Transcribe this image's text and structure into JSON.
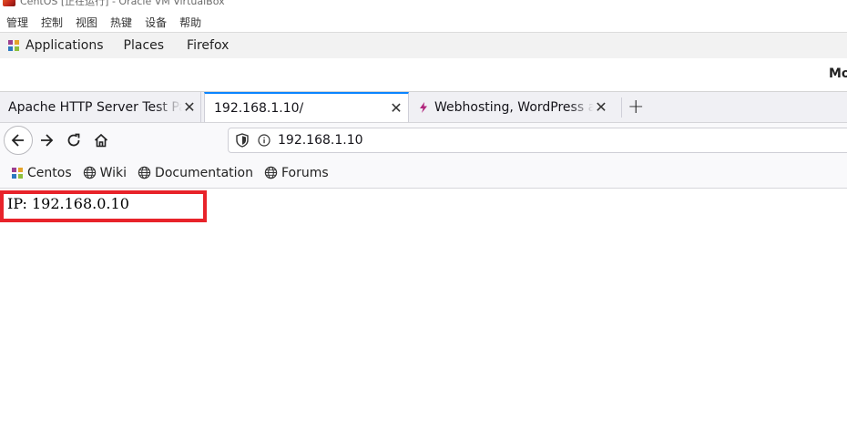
{
  "vbox": {
    "title": "CentOS [正在运行] - Oracle VM VirtualBox",
    "menu": [
      "管理",
      "控制",
      "视图",
      "热键",
      "设备",
      "帮助"
    ]
  },
  "gnome_panel": {
    "applications": "Applications",
    "places": "Places",
    "firefox": "Firefox",
    "right_clipped": "Mon"
  },
  "tabs": [
    {
      "label": "Apache HTTP Server Test Page",
      "active": false
    },
    {
      "label": "192.168.1.10/",
      "active": true
    },
    {
      "label": "Webhosting, WordPress and more",
      "active": false
    }
  ],
  "urlbar": {
    "value": "192.168.1.10"
  },
  "bookmarks": [
    {
      "label": "Centos",
      "icon": "centos-icon"
    },
    {
      "label": "Wiki",
      "icon": "globe-icon"
    },
    {
      "label": "Documentation",
      "icon": "globe-icon"
    },
    {
      "label": "Forums",
      "icon": "globe-icon"
    }
  ],
  "page": {
    "text": "IP: 192.168.0.10"
  },
  "colors": {
    "highlight_border": "#e8232a",
    "active_tab_line": "#0a84ff"
  }
}
